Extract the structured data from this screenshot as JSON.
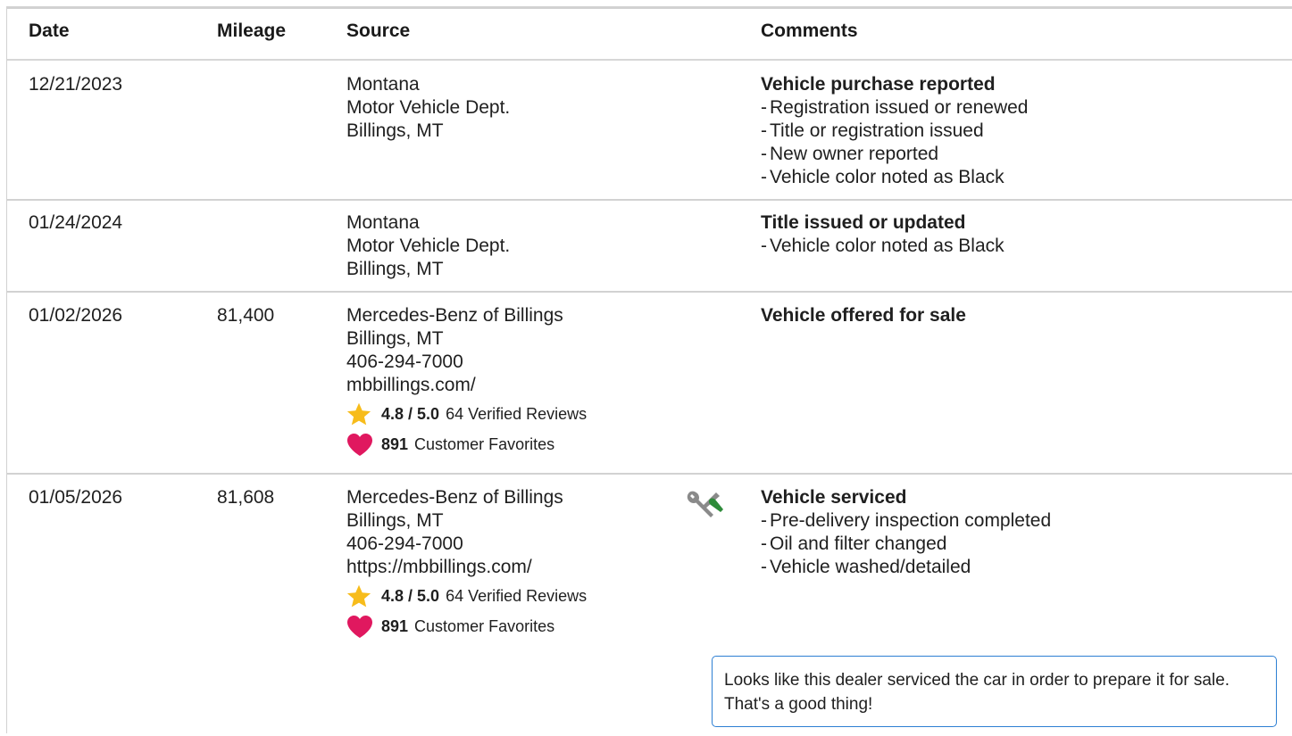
{
  "header": {
    "date": "Date",
    "mileage": "Mileage",
    "source": "Source",
    "comments": "Comments"
  },
  "rows": [
    {
      "date": "12/21/2023",
      "mileage": "",
      "source": [
        "Montana",
        "Motor Vehicle Dept.",
        "Billings, MT"
      ],
      "comment_title": "Vehicle purchase reported",
      "comment_items": [
        "Registration issued or renewed",
        "Title or registration issued",
        "New owner reported",
        "Vehicle color noted as Black"
      ]
    },
    {
      "date": "01/24/2024",
      "mileage": "",
      "source": [
        "Montana",
        "Motor Vehicle Dept.",
        "Billings, MT"
      ],
      "comment_title": "Title issued or updated",
      "comment_items": [
        "Vehicle color noted as Black"
      ]
    },
    {
      "date": "01/02/2026",
      "mileage": "81,400",
      "source": [
        "Mercedes-Benz of Billings",
        "Billings, MT",
        "406-294-7000",
        "mbbillings.com/"
      ],
      "rating": "4.8 / 5.0",
      "reviews": "64 Verified Reviews",
      "favorites_count": "891",
      "favorites_label": "Customer Favorites",
      "comment_title": "Vehicle offered for sale",
      "comment_items": []
    },
    {
      "date": "01/05/2026",
      "mileage": "81,608",
      "source": [
        "Mercedes-Benz of Billings",
        "Billings, MT",
        "406-294-7000",
        "https://mbbillings.com/"
      ],
      "rating": "4.8 / 5.0",
      "reviews": "64 Verified Reviews",
      "favorites_count": "891",
      "favorites_label": "Customer Favorites",
      "icon": "wrench-screwdriver-icon",
      "comment_title": "Vehicle serviced",
      "comment_items": [
        "Pre-delivery inspection completed",
        "Oil and filter changed",
        "Vehicle washed/detailed"
      ]
    }
  ],
  "note": "Looks like this dealer serviced the car in order to prepare it for sale. That's a good thing!",
  "colors": {
    "star": "#f7bc1b",
    "heart": "#e0185f",
    "note_border": "#2d7fd3",
    "screwdriver_handle": "#2e8b3a",
    "wrench": "#8a8a8a"
  }
}
